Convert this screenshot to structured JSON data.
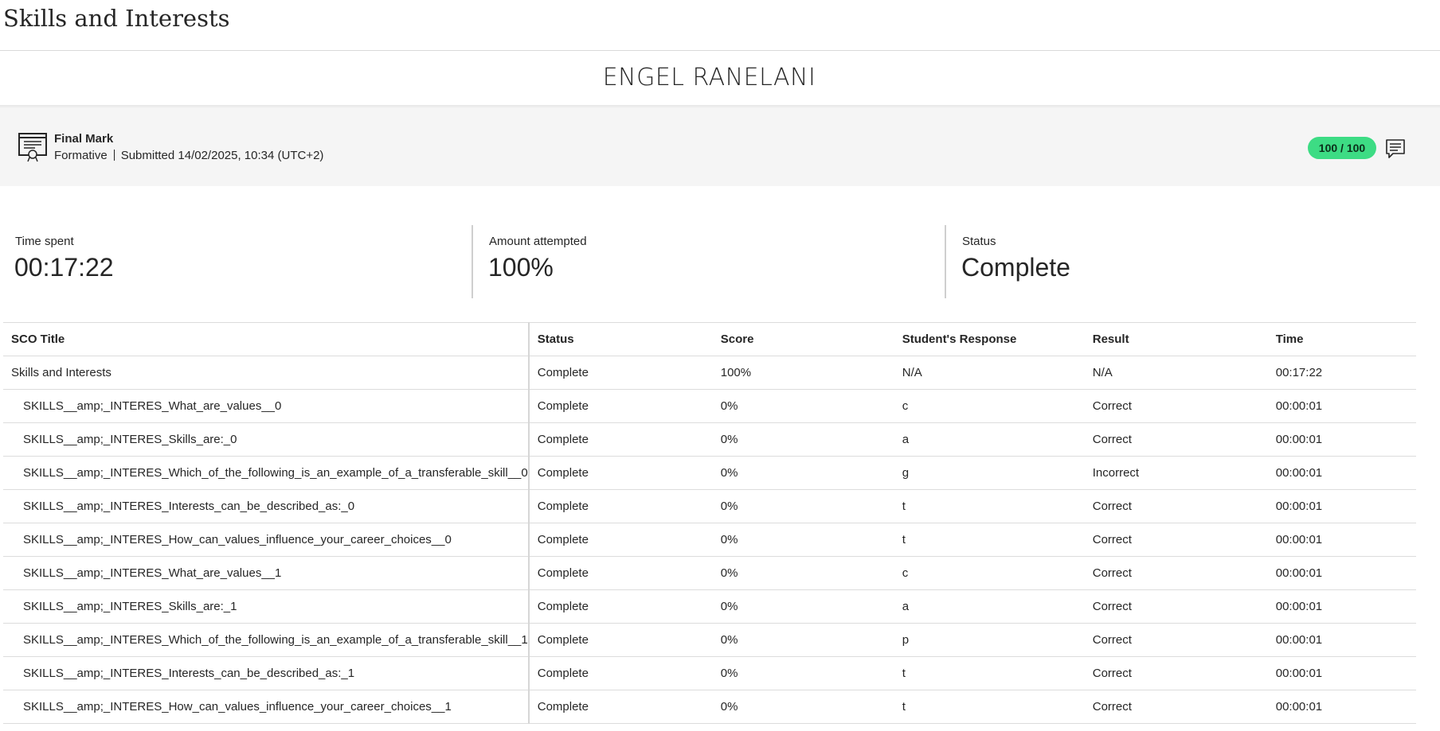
{
  "page": {
    "title": "Skills and Interests"
  },
  "student": {
    "name": "ENGEL RANELANI"
  },
  "final_mark": {
    "label": "Final Mark",
    "type": "Formative",
    "submitted": "Submitted 14/02/2025, 10:34 (UTC+2)",
    "score": "100 / 100",
    "score_color": "#3ddc84"
  },
  "stats": {
    "time_spent_label": "Time spent",
    "time_spent_value": "00:17:22",
    "attempted_label": "Amount attempted",
    "attempted_value": "100%",
    "status_label": "Status",
    "status_value": "Complete"
  },
  "table": {
    "headers": [
      "SCO Title",
      "Status",
      "Score",
      "Student's Response",
      "Result",
      "Time"
    ],
    "rows": [
      {
        "title": "Skills and Interests",
        "status": "Complete",
        "score": "100%",
        "response": "N/A",
        "result": "N/A",
        "time": "00:17:22"
      },
      {
        "title": "SKILLS__amp;_INTERES_What_are_values__0",
        "status": "Complete",
        "score": "0%",
        "response": "c",
        "result": "Correct",
        "time": "00:00:01"
      },
      {
        "title": "SKILLS__amp;_INTERES_Skills_are:_0",
        "status": "Complete",
        "score": "0%",
        "response": "a",
        "result": "Correct",
        "time": "00:00:01"
      },
      {
        "title": "SKILLS__amp;_INTERES_Which_of_the_following_is_an_example_of_a_transferable_skill__0",
        "status": "Complete",
        "score": "0%",
        "response": "g",
        "result": "Incorrect",
        "time": "00:00:01"
      },
      {
        "title": "SKILLS__amp;_INTERES_Interests_can_be_described_as:_0",
        "status": "Complete",
        "score": "0%",
        "response": "t",
        "result": "Correct",
        "time": "00:00:01"
      },
      {
        "title": "SKILLS__amp;_INTERES_How_can_values_influence_your_career_choices__0",
        "status": "Complete",
        "score": "0%",
        "response": "t",
        "result": "Correct",
        "time": "00:00:01"
      },
      {
        "title": "SKILLS__amp;_INTERES_What_are_values__1",
        "status": "Complete",
        "score": "0%",
        "response": "c",
        "result": "Correct",
        "time": "00:00:01"
      },
      {
        "title": "SKILLS__amp;_INTERES_Skills_are:_1",
        "status": "Complete",
        "score": "0%",
        "response": "a",
        "result": "Correct",
        "time": "00:00:01"
      },
      {
        "title": "SKILLS__amp;_INTERES_Which_of_the_following_is_an_example_of_a_transferable_skill__1",
        "status": "Complete",
        "score": "0%",
        "response": "p",
        "result": "Correct",
        "time": "00:00:01"
      },
      {
        "title": "SKILLS__amp;_INTERES_Interests_can_be_described_as:_1",
        "status": "Complete",
        "score": "0%",
        "response": "t",
        "result": "Correct",
        "time": "00:00:01"
      },
      {
        "title": "SKILLS__amp;_INTERES_How_can_values_influence_your_career_choices__1",
        "status": "Complete",
        "score": "0%",
        "response": "t",
        "result": "Correct",
        "time": "00:00:01"
      }
    ]
  }
}
